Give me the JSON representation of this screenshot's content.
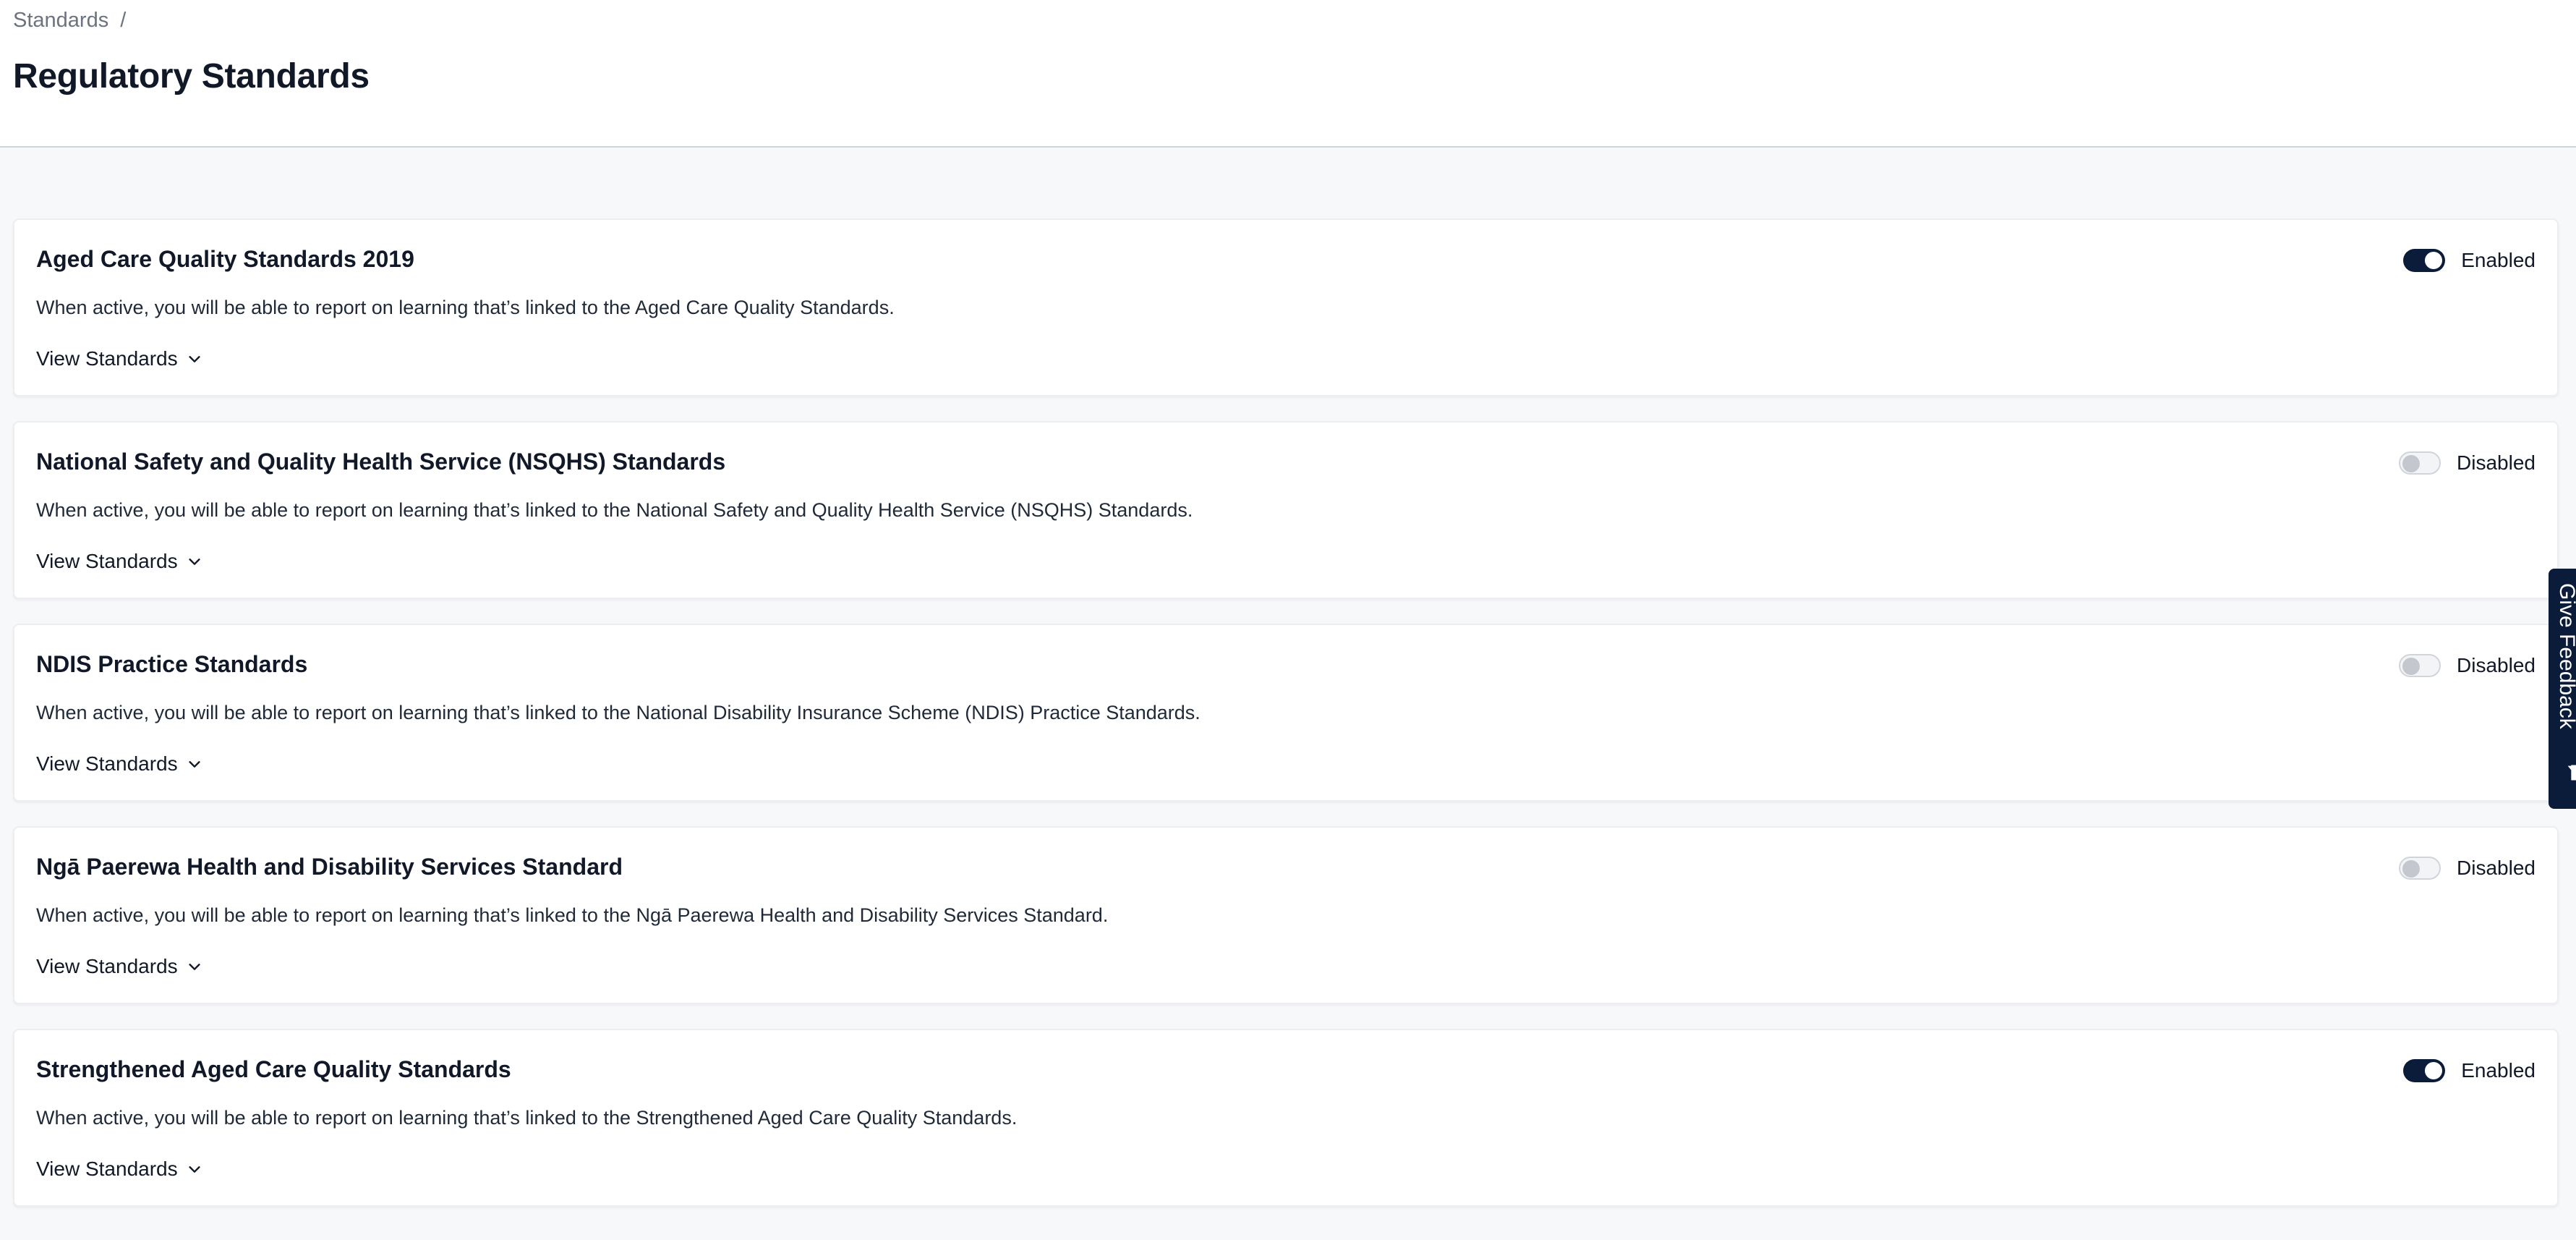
{
  "breadcrumb": {
    "root": "Standards",
    "separator": "/"
  },
  "page": {
    "title": "Regulatory Standards"
  },
  "standards": [
    {
      "title": "Aged Care Quality Standards 2019",
      "description": "When active, you will be able to report on learning that’s linked to the Aged Care Quality Standards.",
      "view_label": "View Standards",
      "enabled": true,
      "status": "Enabled"
    },
    {
      "title": "National Safety and Quality Health Service (NSQHS) Standards",
      "description": "When active, you will be able to report on learning that’s linked to the National Safety and Quality Health Service (NSQHS) Standards.",
      "view_label": "View Standards",
      "enabled": false,
      "status": "Disabled"
    },
    {
      "title": "NDIS Practice Standards",
      "description": "When active, you will be able to report on learning that’s linked to the National Disability Insurance Scheme (NDIS) Practice Standards.",
      "view_label": "View Standards",
      "enabled": false,
      "status": "Disabled"
    },
    {
      "title": "Ngā Paerewa Health and Disability Services Standard",
      "description": "When active, you will be able to report on learning that’s linked to the Ngā Paerewa Health and Disability Services Standard.",
      "view_label": "View Standards",
      "enabled": false,
      "status": "Disabled"
    },
    {
      "title": "Strengthened Aged Care Quality Standards",
      "description": "When active, you will be able to report on learning that’s linked to the Strengthened Aged Care Quality Standards.",
      "view_label": "View Standards",
      "enabled": true,
      "status": "Enabled"
    }
  ],
  "feedback": {
    "label": "Give Feedback",
    "icon": "feedback-icon"
  },
  "colors": {
    "toggle_on": "#0b1b3a",
    "toggle_off": "#f3f4f6",
    "feedback_bg": "#0b1b3a",
    "page_bg": "#f7f8fa"
  }
}
